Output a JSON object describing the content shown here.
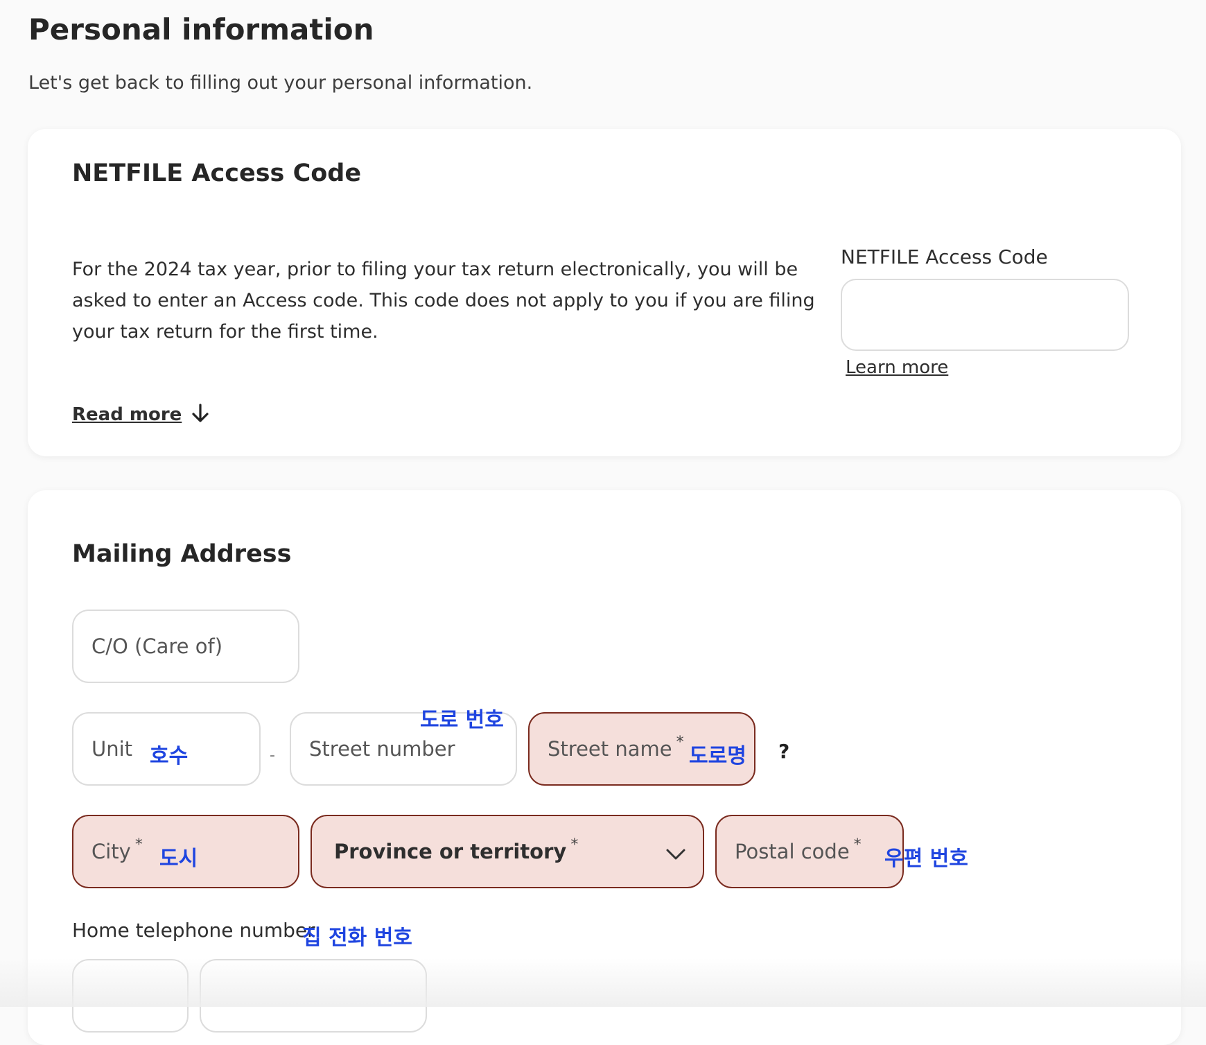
{
  "page": {
    "title": "Personal information",
    "subtitle": "Let's get back to filling out your personal information."
  },
  "netfile": {
    "title": "NETFILE Access Code",
    "description": "For the 2024 tax year, prior to filing your tax return electronically, you will be asked to enter an Access code. This code does not apply to you if you are filing your tax return for the first time.",
    "field_label": "NETFILE Access Code",
    "field_value": "",
    "learn_more": "Learn more",
    "read_more": "Read more"
  },
  "mailing": {
    "title": "Mailing Address",
    "care_of": {
      "placeholder": "C/O (Care of)"
    },
    "unit": {
      "placeholder": "Unit",
      "annotation": "호수"
    },
    "dash": "-",
    "street_number": {
      "placeholder": "Street number",
      "annotation": "도로 번호"
    },
    "street_name": {
      "placeholder": "Street name",
      "required_mark": "*",
      "annotation": "도로명"
    },
    "help": "?",
    "city": {
      "placeholder": "City",
      "required_mark": "*",
      "annotation": "도시"
    },
    "province": {
      "placeholder": "Province or territory",
      "required_mark": "*"
    },
    "postal_code": {
      "placeholder": "Postal code",
      "required_mark": "*",
      "annotation": "우편 번호"
    },
    "home_phone": {
      "label": "Home telephone number",
      "annotation": "집 전화 번호"
    }
  },
  "colors": {
    "required_bg": "#f5dfdb",
    "required_border": "#7a2b1f",
    "annotation": "#1f45e0"
  },
  "icons": {
    "read_more": "arrow-down-icon",
    "province": "chevron-down-icon",
    "help": "question-mark-icon"
  }
}
